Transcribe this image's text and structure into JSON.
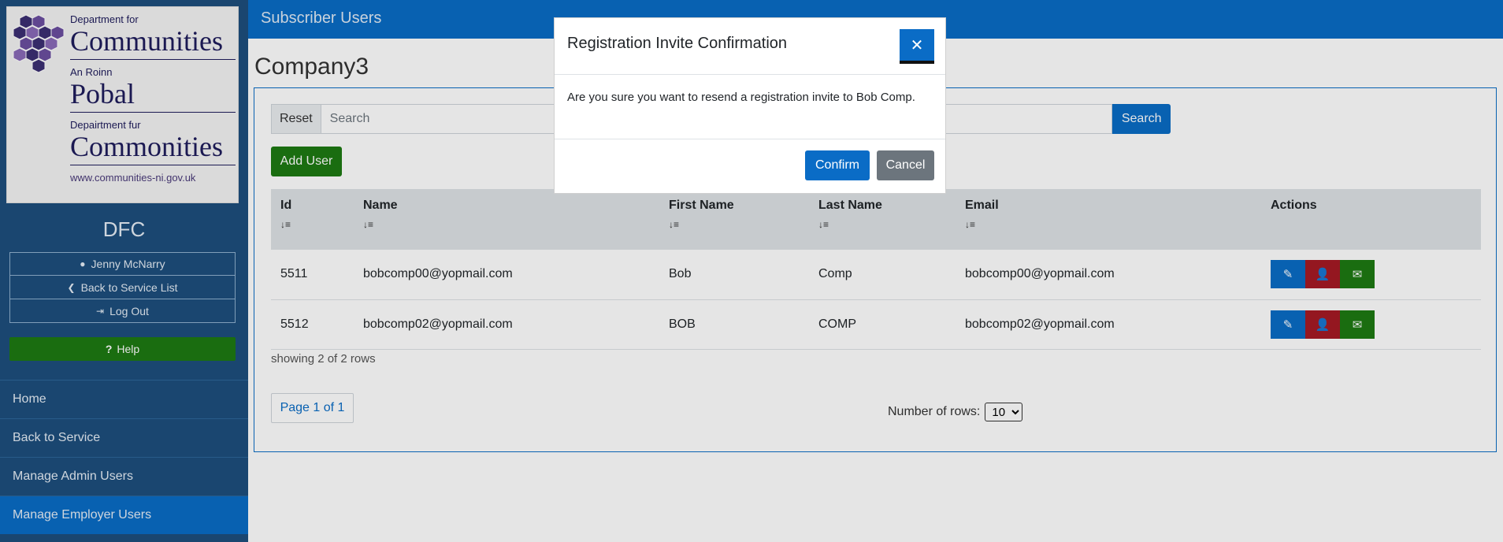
{
  "header": {
    "title": "Subscriber Users"
  },
  "sidebar": {
    "logo": {
      "line1_small": "Department for",
      "line1_big": "Communities",
      "line2_small": "An Roinn",
      "line2_big": "Pobal",
      "line3_small": "Depairtment fur",
      "line3_big": "Commonities",
      "url": "www.communities-ni.gov.uk"
    },
    "org_name": "DFC",
    "user_links": [
      {
        "label": "Jenny McNarry",
        "icon": "user-circle-icon"
      },
      {
        "label": "Back to Service List",
        "icon": "chevron-left-icon"
      },
      {
        "label": "Log Out",
        "icon": "sign-out-icon"
      }
    ],
    "help_label": "Help",
    "nav": [
      {
        "label": "Home"
      },
      {
        "label": "Back to Service"
      },
      {
        "label": "Manage Admin Users"
      },
      {
        "label": "Manage Employer Users"
      }
    ]
  },
  "main": {
    "page_title": "Company3",
    "reset_label": "Reset",
    "search_placeholder": "Search",
    "search_label": "Search",
    "add_user_label": "Add User",
    "table": {
      "columns": [
        "Id",
        "Name",
        "First Name",
        "Last Name",
        "Email",
        "Actions"
      ],
      "sort_glyph": "↓≡",
      "rows": [
        {
          "id": "5511",
          "name": "bobcomp00@yopmail.com",
          "first": "Bob",
          "last": "Comp",
          "email": "bobcomp00@yopmail.com"
        },
        {
          "id": "5512",
          "name": "bobcomp02@yopmail.com",
          "first": "BOB",
          "last": "COMP",
          "email": "bobcomp02@yopmail.com"
        }
      ]
    },
    "showing": "showing 2 of 2 rows",
    "page_label": "Page 1 of 1",
    "rows_label": "Number of rows:",
    "rows_value": "10"
  },
  "modal": {
    "title": "Registration Invite Confirmation",
    "body": "Are you sure you want to resend a registration invite to Bob Comp.",
    "confirm_label": "Confirm",
    "cancel_label": "Cancel"
  },
  "colors": {
    "sidebar_bg": "#1e4f7d",
    "primary": "#0a6cc6",
    "success": "#1d7a12",
    "danger": "#a51a24",
    "secondary": "#6c757d"
  }
}
